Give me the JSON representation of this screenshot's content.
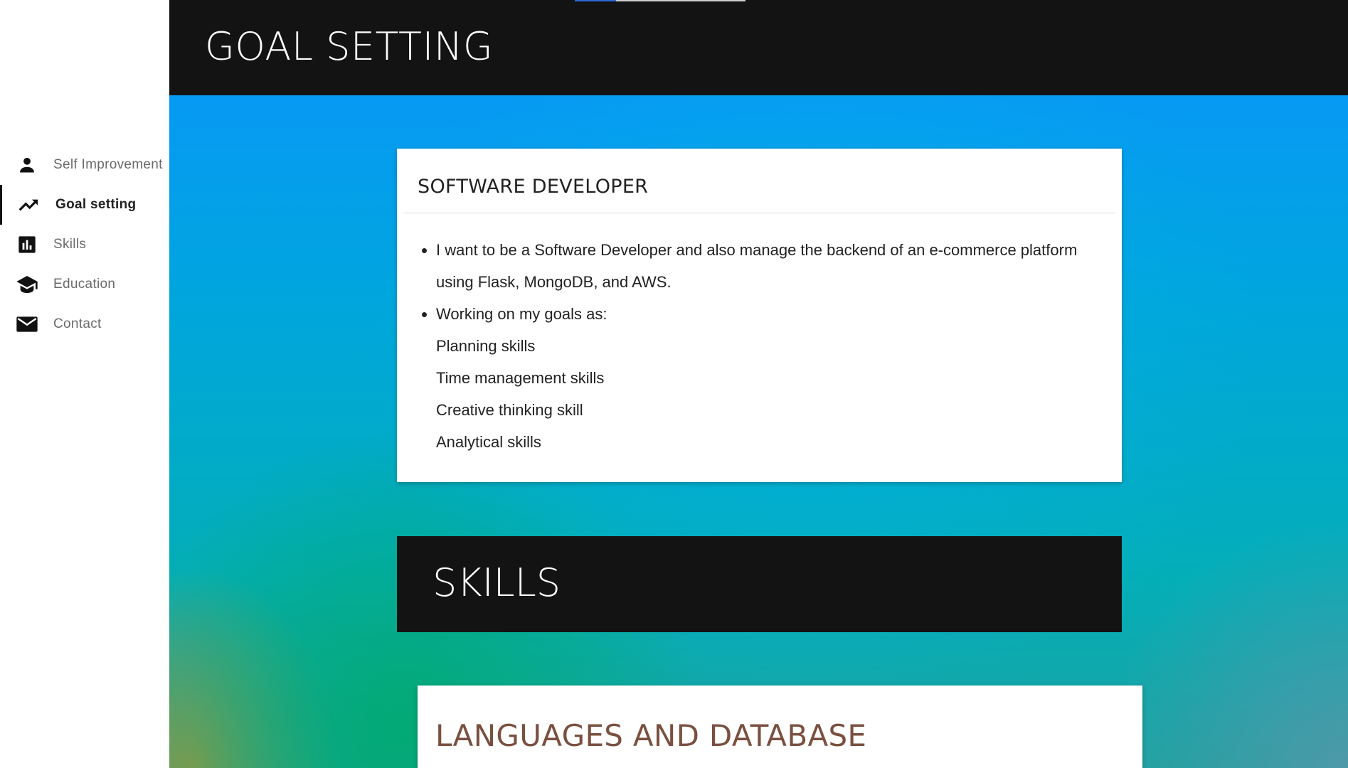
{
  "sidebar": {
    "items": [
      {
        "label": "Self Improvement",
        "icon": "person-icon"
      },
      {
        "label": "Goal setting",
        "icon": "trending-up-icon",
        "active": true
      },
      {
        "label": "Skills",
        "icon": "bar-chart-icon"
      },
      {
        "label": "Education",
        "icon": "school-icon"
      },
      {
        "label": "Contact",
        "icon": "mail-icon"
      }
    ]
  },
  "header": {
    "title": "GOAL SETTING"
  },
  "goal_card": {
    "title": "SOFTWARE DEVELOPER",
    "bullet_1": "I want to be a Software Developer and also manage the backend of an e-commerce platform using Flask, MongoDB, and AWS.",
    "bullet_2": "Working on my goals as:",
    "goals": [
      "Planning skills",
      "Time management skills",
      "Creative thinking skill",
      "Analytical skills"
    ]
  },
  "skills_section": {
    "title": "SKILLS"
  },
  "languages_card": {
    "title": "LANGUAGES AND DATABASE"
  },
  "colors": {
    "header_bg": "#131313",
    "card_bg": "#ffffff",
    "languages_title": "#7a5040"
  }
}
